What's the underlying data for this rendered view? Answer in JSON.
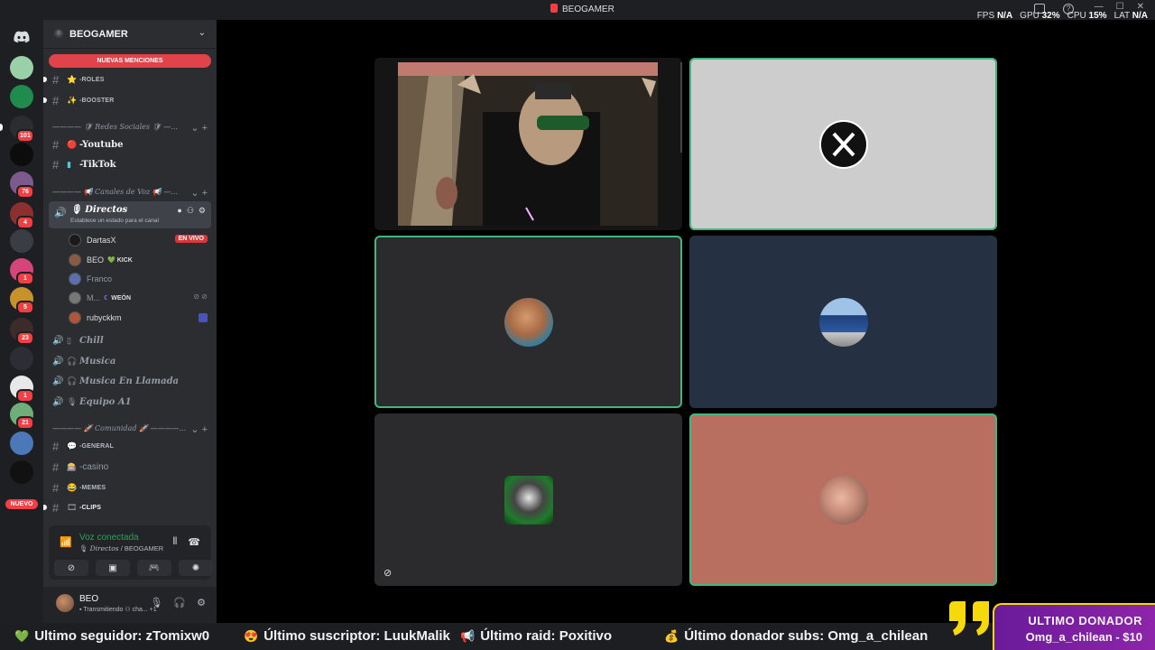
{
  "window": {
    "title": "BEOGAMER",
    "stats": [
      {
        "label": "FPS",
        "value": "N/A"
      },
      {
        "label": "GPU",
        "value": "32%"
      },
      {
        "label": "CPU",
        "value": "15%"
      },
      {
        "label": "LAT",
        "value": "N/A"
      }
    ]
  },
  "rail": {
    "servers": [
      {
        "color": "#9ad0a8",
        "badge": ""
      },
      {
        "color": "#1f8b4c",
        "badge": ""
      },
      {
        "color": "#2b2d31",
        "badge": "101"
      },
      {
        "color": "#0c0c0c",
        "badge": ""
      },
      {
        "color": "#7c5a8e",
        "badge": "76"
      },
      {
        "color": "#8b2f2f",
        "badge": "4"
      },
      {
        "color": "#3a3d44",
        "badge": ""
      },
      {
        "color": "#d6457a",
        "badge": "1"
      },
      {
        "color": "#c7922c",
        "badge": "5"
      },
      {
        "color": "#3d2b2b",
        "badge": "23"
      },
      {
        "color": "#2d2d35",
        "badge": ""
      },
      {
        "color": "#e8e8e8",
        "badge": "1"
      },
      {
        "color": "#6fae78",
        "badge": "21"
      },
      {
        "color": "#4a78b8",
        "badge": ""
      },
      {
        "color": "#111111",
        "badge": ""
      }
    ],
    "new_label": "NUEVO"
  },
  "sidebar": {
    "guild_name": "BEOGAMER",
    "mentions_label": "NUEVAS MENCIONES",
    "channels_top": [
      {
        "emoji": "⭐",
        "name": "-ROLES",
        "style": "small"
      },
      {
        "emoji": "✨",
        "name": "-BOOSTER",
        "style": "small"
      }
    ],
    "cat_redes": "Redes Sociales",
    "channels_redes": [
      {
        "emoji": "🔴",
        "name": "-Youtube"
      },
      {
        "emoji": "▮",
        "name": "-TikTok"
      }
    ],
    "cat_canales": "Canales de Voz",
    "voice_active": {
      "name": "Directos",
      "status": "Establece un estado para el canal"
    },
    "voice_users": [
      {
        "name": "DartasX",
        "tag": "",
        "live": "EN VIVO",
        "color": "#1a1a1a"
      },
      {
        "name": "BEO",
        "tag": "KICK",
        "live": "",
        "color": "#8a5a44"
      },
      {
        "name": "Franco",
        "tag": "",
        "live": "",
        "color": "#5b6eae"
      },
      {
        "name": "M...",
        "tag": "WEÓN",
        "live": "",
        "color": "#777777"
      },
      {
        "name": "rubyckkm",
        "tag": "",
        "live": "",
        "color": "#b0553a"
      }
    ],
    "voice_channels": [
      {
        "emoji": "▯",
        "name": "Chill"
      },
      {
        "emoji": "🎧",
        "name": "Musica"
      },
      {
        "emoji": "🎧",
        "name": "Musica En Llamada"
      },
      {
        "emoji": "🎙",
        "name": "Equipo A1"
      }
    ],
    "cat_comunidad": "Comunidad",
    "channels_comunidad": [
      {
        "emoji": "💬",
        "name": "-GENERAL",
        "style": "small"
      },
      {
        "emoji": "🎰",
        "name": "-casino",
        "style": "normal"
      },
      {
        "emoji": "😂",
        "name": "-MEMES",
        "style": "small"
      },
      {
        "emoji": "🎞",
        "name": "-CLIPS",
        "style": "small"
      }
    ],
    "voice_connected": "Voz conectada",
    "voice_connected_channel": "Directos",
    "voice_connected_guild": "/ BEOGAMER",
    "user_name": "BEO",
    "user_status": "Transmitiendo",
    "user_status_extra": "cha...",
    "user_status_count": "+1"
  },
  "ticker": {
    "seguidor": "Ultimo seguidor: zTomixw0",
    "suscriptor": "Último suscriptor: LuukMalik",
    "raid": "Último raid: Poxitivo",
    "donador_subs": "Último donador subs: Omg_a_chilean"
  },
  "donor_box": {
    "title": "ULTIMO DONADOR",
    "value": "Omg_a_chilean - $10"
  }
}
